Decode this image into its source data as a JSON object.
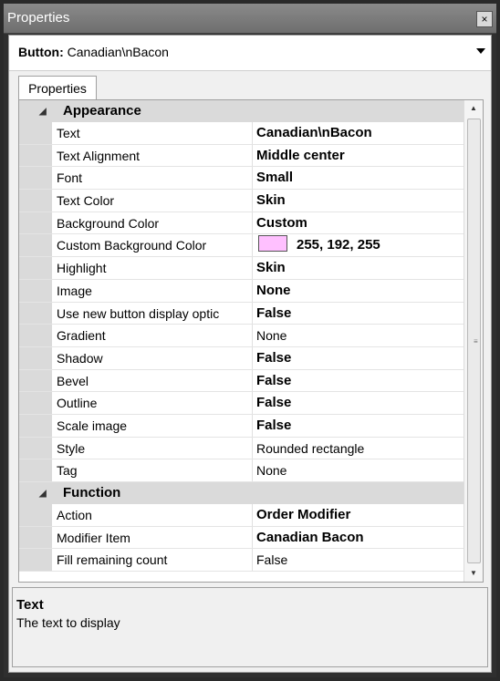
{
  "window": {
    "title": "Properties",
    "close_glyph": "×"
  },
  "object_selector": {
    "type_label": "Button:",
    "object_name": "Canadian\\nBacon"
  },
  "tabs": [
    {
      "label": "Properties",
      "selected": true
    }
  ],
  "categories": [
    {
      "name": "Appearance",
      "expanded": true,
      "properties": [
        {
          "name": "Text",
          "value": "Canadian\\nBacon",
          "bold": true
        },
        {
          "name": "Text Alignment",
          "value": "Middle center",
          "bold": true
        },
        {
          "name": "Font",
          "value": "Small",
          "bold": true
        },
        {
          "name": "Text Color",
          "value": "Skin",
          "bold": true
        },
        {
          "name": "Background Color",
          "value": "Custom",
          "bold": true
        },
        {
          "name": "Custom Background Color",
          "value": "255, 192, 255",
          "bold": true,
          "swatch": "#ffc0ff"
        },
        {
          "name": "Highlight",
          "value": "Skin",
          "bold": true
        },
        {
          "name": "Image",
          "value": "None",
          "bold": true
        },
        {
          "name": "Use new button display optic",
          "value": "False",
          "bold": true
        },
        {
          "name": "Gradient",
          "value": "None",
          "bold": false
        },
        {
          "name": "Shadow",
          "value": "False",
          "bold": true
        },
        {
          "name": "Bevel",
          "value": "False",
          "bold": true
        },
        {
          "name": "Outline",
          "value": "False",
          "bold": true
        },
        {
          "name": "Scale image",
          "value": "False",
          "bold": true
        },
        {
          "name": "Style",
          "value": "Rounded rectangle",
          "bold": false
        },
        {
          "name": "Tag",
          "value": "None",
          "bold": false
        }
      ]
    },
    {
      "name": "Function",
      "expanded": true,
      "properties": [
        {
          "name": "Action",
          "value": "Order Modifier",
          "bold": true
        },
        {
          "name": "Modifier Item",
          "value": "Canadian Bacon",
          "bold": true
        },
        {
          "name": "Fill remaining count",
          "value": "False",
          "bold": false
        }
      ]
    }
  ],
  "description": {
    "title": "Text",
    "text": "The text to display"
  },
  "colors": {
    "titlebar": "#7a7a7a",
    "category_band": "#dadada",
    "custom_swatch": "#ffc0ff"
  },
  "icons": {
    "collapse": "collapse-triangle-icon",
    "dropdown": "dropdown-arrow-icon",
    "close": "close-icon"
  }
}
